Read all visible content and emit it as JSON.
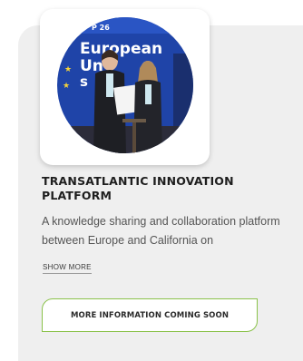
{
  "card": {
    "title": "TRANSATLANTIC INNOVATION PLATFORM",
    "description": "A knowledge sharing and collaboration platform between Europe and California on",
    "show_more_label": "SHOW MORE",
    "cta_label": "MORE INFORMATION COMING SOON"
  },
  "photo": {
    "banner_lines": [
      "European",
      "Un",
      "s"
    ],
    "banner_badge": "P 26"
  },
  "colors": {
    "card_background": "#efefef",
    "cta_border": "#8ac24a",
    "title_text": "#1e1e1e",
    "body_text": "#555555",
    "photo_banner_blue": "#1f44a8"
  }
}
